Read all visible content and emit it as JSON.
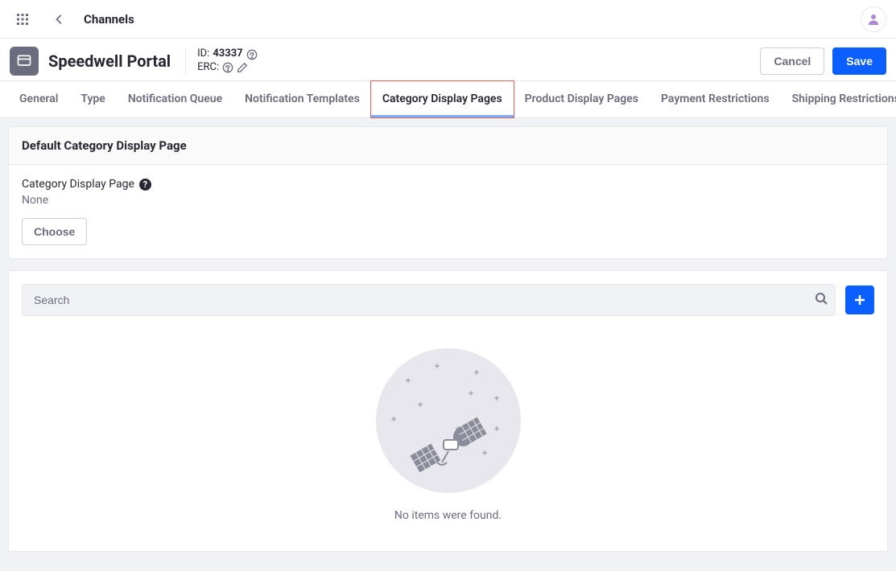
{
  "topbar": {
    "breadcrumb": "Channels"
  },
  "header": {
    "site_title": "Speedwell Portal",
    "id_label": "ID:",
    "id_value": "43337",
    "erc_label": "ERC:",
    "cancel_label": "Cancel",
    "save_label": "Save"
  },
  "tabs": [
    {
      "label": "General",
      "active": false
    },
    {
      "label": "Type",
      "active": false
    },
    {
      "label": "Notification Queue",
      "active": false
    },
    {
      "label": "Notification Templates",
      "active": false
    },
    {
      "label": "Category Display Pages",
      "active": true,
      "highlighted": true
    },
    {
      "label": "Product Display Pages",
      "active": false
    },
    {
      "label": "Payment Restrictions",
      "active": false
    },
    {
      "label": "Shipping Restrictions",
      "active": false
    }
  ],
  "panel": {
    "title": "Default Category Display Page",
    "field_label": "Category Display Page",
    "field_value": "None",
    "choose_label": "Choose"
  },
  "search": {
    "placeholder": "Search"
  },
  "empty": {
    "message": "No items were found."
  }
}
